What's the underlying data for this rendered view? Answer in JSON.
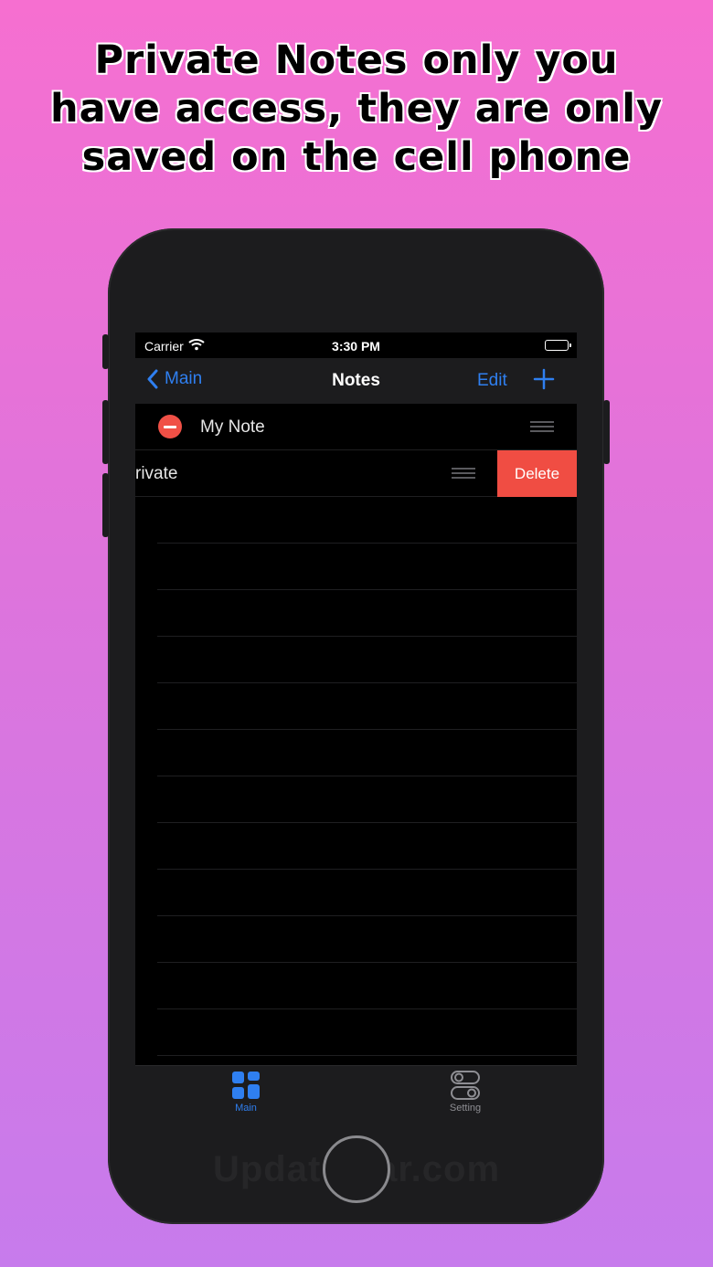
{
  "headline": {
    "line1": "Private Notes only you",
    "line2": "have access, they are only",
    "line3": "saved on the cell phone"
  },
  "status_bar": {
    "carrier": "Carrier",
    "time": "3:30 PM",
    "wifi_icon": "wifi-icon",
    "battery_icon": "battery-icon"
  },
  "nav": {
    "back_label": "Main",
    "title": "Notes",
    "edit_label": "Edit",
    "add_icon": "plus-icon"
  },
  "notes": [
    {
      "label": "My Note",
      "editing": true
    },
    {
      "label": "rivate",
      "swiped": true
    }
  ],
  "delete_label": "Delete",
  "tabs": [
    {
      "label": "Main",
      "icon": "grid-icon",
      "selected": true
    },
    {
      "label": "Setting",
      "icon": "toggles-icon",
      "selected": false
    }
  ],
  "watermark": "Updatestar.com",
  "colors": {
    "accent": "#2f7ff0",
    "destructive": "#f04d43",
    "background_top": "#f66fd0",
    "background_bottom": "#c77bec"
  }
}
